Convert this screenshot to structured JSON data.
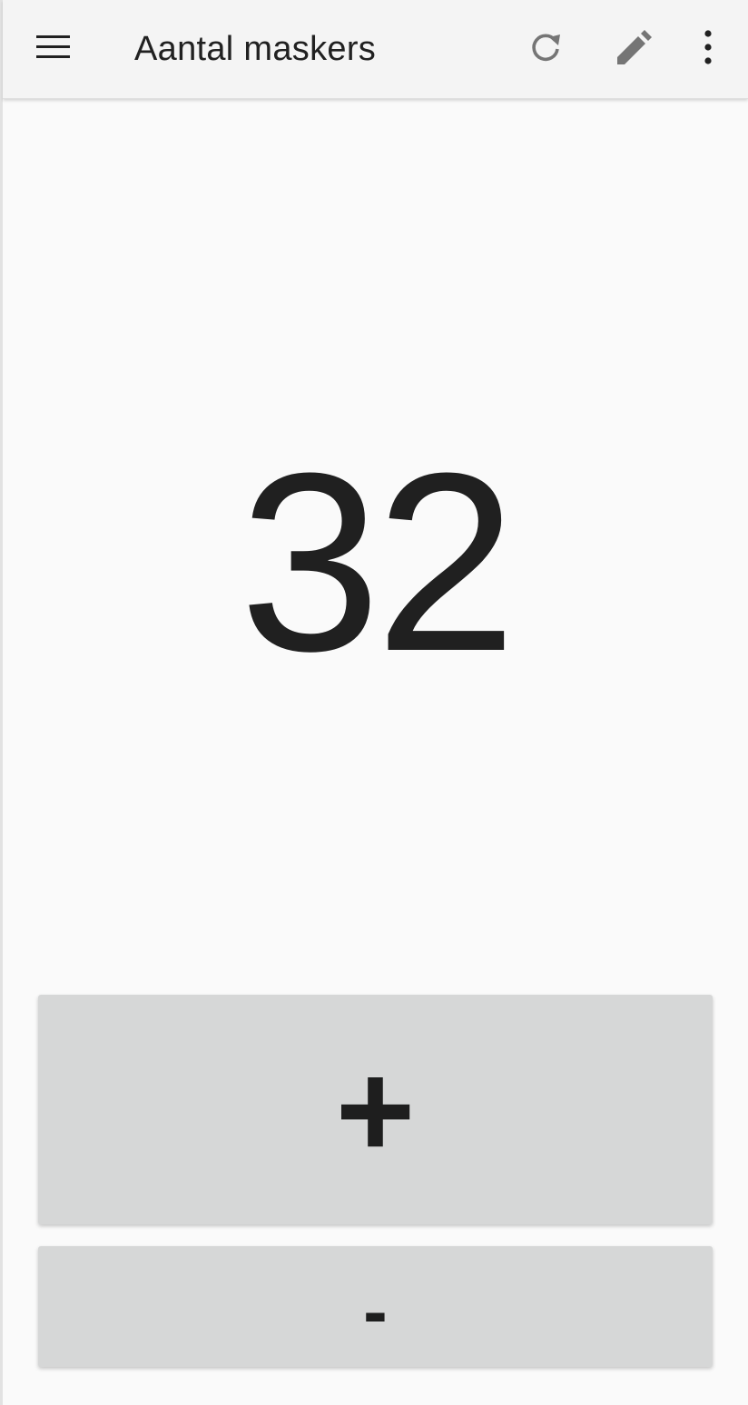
{
  "appbar": {
    "title": "Aantal maskers",
    "icons": {
      "menu": "menu-icon",
      "refresh": "refresh-icon",
      "edit": "pencil-icon",
      "more": "more-vert-icon"
    }
  },
  "counter": {
    "value": "32"
  },
  "buttons": {
    "increment_label": "+",
    "decrement_label": "-"
  },
  "colors": {
    "appbar_bg": "#f4f4f4",
    "page_bg": "#fafafa",
    "button_bg": "#d6d7d7",
    "icon_gray": "#757575",
    "text_dark": "#212121"
  }
}
